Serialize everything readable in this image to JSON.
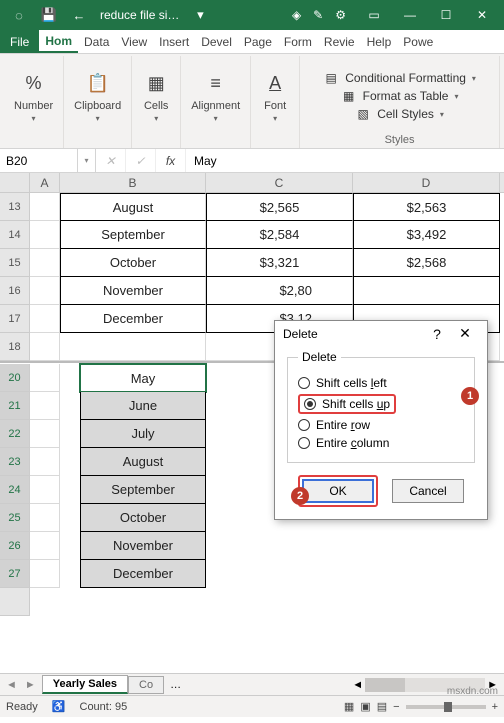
{
  "title": "reduce file si…",
  "ribbon_tabs": [
    "File",
    "Hom",
    "Data",
    "View",
    "Insert",
    "Devel",
    "Page",
    "Form",
    "Revie",
    "Help",
    "Powe"
  ],
  "groups": {
    "number": "Number",
    "clipboard": "Clipboard",
    "cells": "Cells",
    "alignment": "Alignment",
    "font": "Font",
    "styles": "Styles"
  },
  "styles_items": {
    "cond": "Conditional Formatting",
    "table": "Format as Table",
    "cell": "Cell Styles"
  },
  "name_box": "B20",
  "formula_value": "May",
  "columns": [
    "A",
    "B",
    "C",
    "D"
  ],
  "row_labels": [
    "13",
    "14",
    "15",
    "16",
    "17",
    "18",
    "20",
    "21",
    "22",
    "23",
    "24",
    "25",
    "26",
    "27"
  ],
  "data_rows": [
    {
      "b": "August",
      "c": "$2,565",
      "d": "$2,563"
    },
    {
      "b": "September",
      "c": "$2,584",
      "d": "$3,492"
    },
    {
      "b": "October",
      "c": "$3,321",
      "d": "$2,568"
    },
    {
      "b": "November",
      "c": "$2,80",
      "d": ""
    },
    {
      "b": "December",
      "c": "$3,12",
      "d": ""
    }
  ],
  "sel_block": [
    "May",
    "June",
    "July",
    "August",
    "September",
    "October",
    "November",
    "December"
  ],
  "sheet_tabs": {
    "active": "Yearly Sales",
    "other": "Co"
  },
  "dialog": {
    "title": "Delete",
    "group": "Delete",
    "opts": {
      "left": "Shift cells left",
      "up": "Shift cells up",
      "row": "Entire row",
      "col": "Entire column"
    },
    "ok": "OK",
    "cancel": "Cancel"
  },
  "status": {
    "ready": "Ready",
    "count": "Count: 95",
    "zoom": "100%"
  },
  "watermark": "msxdn.com"
}
